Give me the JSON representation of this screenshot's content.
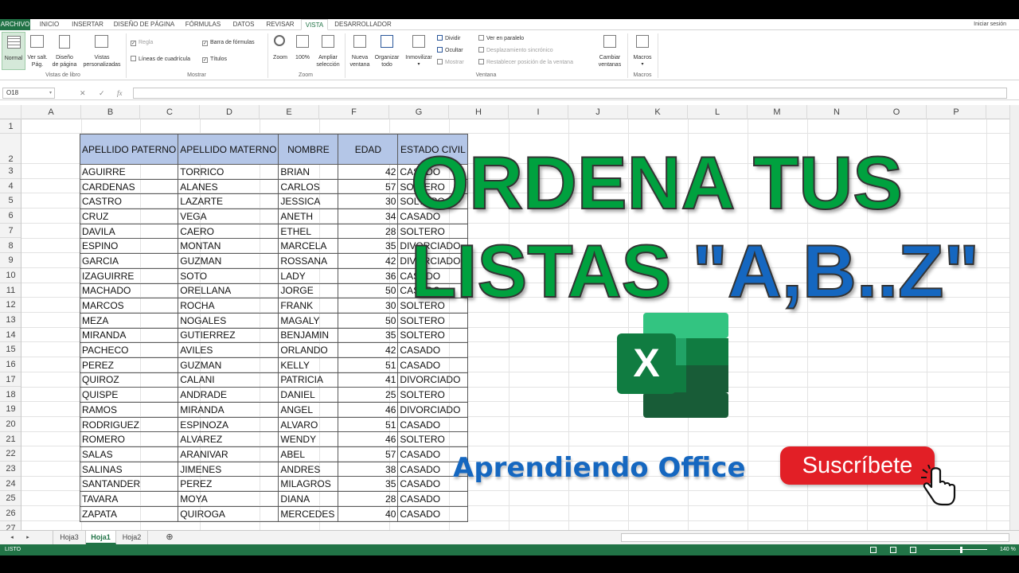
{
  "ribbon_tabs": [
    "ARCHIVO",
    "INICIO",
    "INSERTAR",
    "DISEÑO DE PÁGINA",
    "FÓRMULAS",
    "DATOS",
    "REVISAR",
    "VISTA",
    "DESARROLLADOR"
  ],
  "active_tab": "VISTA",
  "sign_in": "Iniciar sesión",
  "ribbon": {
    "normal": "Normal",
    "ver_salt_1": "Ver salt.",
    "ver_salt_2": "Pág.",
    "diseno_1": "Diseño",
    "diseno_2": "de página",
    "vistas_1": "Vistas",
    "vistas_2": "personalizadas",
    "group_vistas": "Vistas de libro",
    "regla": "Regla",
    "barra": "Barra de fórmulas",
    "lineas": "Líneas de cuadrícula",
    "titulos": "Títulos",
    "group_mostrar": "Mostrar",
    "zoom": "Zoom",
    "zoom100": "100%",
    "ampliar_1": "Ampliar",
    "ampliar_2": "selección",
    "group_zoom": "Zoom",
    "nueva_1": "Nueva",
    "nueva_2": "ventana",
    "organizar_1": "Organizar",
    "organizar_2": "todo",
    "inmovilizar": "Inmovilizar",
    "dividir": "Dividir",
    "ocultar": "Ocultar",
    "mostrar": "Mostrar",
    "paralelo": "Ver en paralelo",
    "desplazamiento": "Desplazamiento sincrónico",
    "restablecer": "Restablecer posición de la ventana",
    "cambiar_1": "Cambiar",
    "cambiar_2": "ventanas",
    "group_ventana": "Ventana",
    "macros": "Macros",
    "group_macros": "Macros"
  },
  "name_box": "O18",
  "columns": [
    "A",
    "B",
    "C",
    "D",
    "E",
    "F",
    "G",
    "H",
    "I",
    "J",
    "K",
    "L",
    "M",
    "N",
    "O",
    "P"
  ],
  "rows": [
    "1",
    "2",
    "3",
    "4",
    "5",
    "6",
    "7",
    "8",
    "9",
    "10",
    "11",
    "12",
    "13",
    "14",
    "15",
    "16",
    "17",
    "18",
    "19",
    "20",
    "21",
    "22",
    "23",
    "24",
    "25",
    "26",
    "27"
  ],
  "table": {
    "headers": [
      "APELLIDO PATERNO",
      "APELLIDO MATERNO",
      "NOMBRE",
      "EDAD",
      "ESTADO CIVIL"
    ],
    "rows": [
      [
        "AGUIRRE",
        "TORRICO",
        "BRIAN",
        "42",
        "CASADO"
      ],
      [
        "CARDENAS",
        "ALANES",
        "CARLOS",
        "57",
        "SOLTERO"
      ],
      [
        "CASTRO",
        "LAZARTE",
        "JESSICA",
        "30",
        "SOLTERO"
      ],
      [
        "CRUZ",
        "VEGA",
        "ANETH",
        "34",
        "CASADO"
      ],
      [
        "DAVILA",
        "CAERO",
        "ETHEL",
        "28",
        "SOLTERO"
      ],
      [
        "ESPINO",
        "MONTAN",
        "MARCELA",
        "35",
        "DIVORCIADO"
      ],
      [
        "GARCIA",
        "GUZMAN",
        "ROSSANA",
        "42",
        "DIVORCIADO"
      ],
      [
        "IZAGUIRRE",
        "SOTO",
        "LADY",
        "36",
        "CASADO"
      ],
      [
        "MACHADO",
        "ORELLANA",
        "JORGE",
        "50",
        "CASADO"
      ],
      [
        "MARCOS",
        "ROCHA",
        "FRANK",
        "30",
        "SOLTERO"
      ],
      [
        "MEZA",
        "NOGALES",
        "MAGALY",
        "50",
        "SOLTERO"
      ],
      [
        "MIRANDA",
        "GUTIERREZ",
        "BENJAMIN",
        "35",
        "SOLTERO"
      ],
      [
        "PACHECO",
        "AVILES",
        "ORLANDO",
        "42",
        "CASADO"
      ],
      [
        "PEREZ",
        "GUZMAN",
        "KELLY",
        "51",
        "CASADO"
      ],
      [
        "QUIROZ",
        "CALANI",
        "PATRICIA",
        "41",
        "DIVORCIADO"
      ],
      [
        "QUISPE",
        "ANDRADE",
        "DANIEL",
        "25",
        "SOLTERO"
      ],
      [
        "RAMOS",
        "MIRANDA",
        "ANGEL",
        "46",
        "DIVORCIADO"
      ],
      [
        "RODRIGUEZ",
        "ESPINOZA",
        "ALVARO",
        "51",
        "CASADO"
      ],
      [
        "ROMERO",
        "ALVAREZ",
        "WENDY",
        "46",
        "SOLTERO"
      ],
      [
        "SALAS",
        "ARANIVAR",
        "ABEL",
        "57",
        "CASADO"
      ],
      [
        "SALINAS",
        "JIMENES",
        "ANDRES",
        "38",
        "CASADO"
      ],
      [
        "SANTANDER",
        "PEREZ",
        "MILAGROS",
        "35",
        "CASADO"
      ],
      [
        "TAVARA",
        "MOYA",
        "DIANA",
        "28",
        "CASADO"
      ],
      [
        "ZAPATA",
        "QUIROGA",
        "MERCEDES",
        "40",
        "CASADO"
      ]
    ]
  },
  "title_line1": "ORDENA TUS",
  "title_line2_a": "LISTAS ",
  "title_line2_b": "\"A,B..Z\"",
  "brand": "Aprendiendo Office",
  "subscribe": "Suscríbete",
  "sheets": [
    "Hoja3",
    "Hoja1",
    "Hoja2"
  ],
  "active_sheet": "Hoja1",
  "status": "LISTO",
  "zoom_level": "140 %",
  "colors": {
    "excel_green": "#217346",
    "title_green": "#00a13f",
    "title_blue": "#1567c0",
    "header_fill": "#b4c6e7",
    "subscribe_red": "#e21f26"
  }
}
